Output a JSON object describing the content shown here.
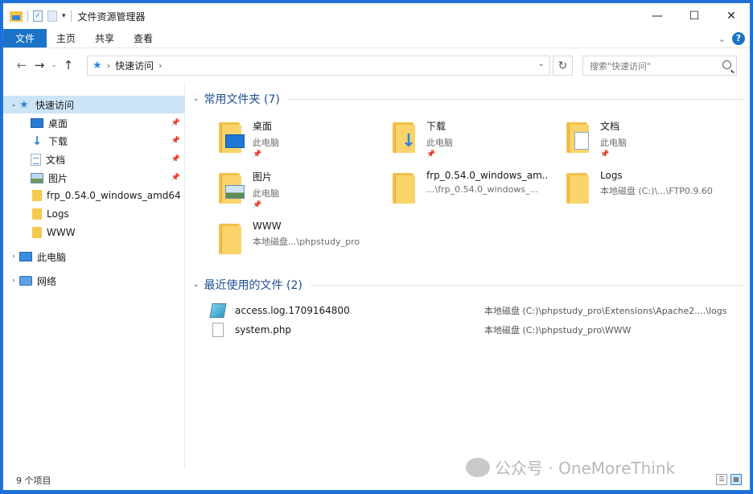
{
  "window": {
    "title": "文件资源管理器"
  },
  "ribbon": {
    "tabs": [
      "文件",
      "主页",
      "共享",
      "查看"
    ]
  },
  "navbar": {
    "breadcrumb": "快速访问",
    "search_placeholder": "搜索\"快速访问\""
  },
  "sidebar": {
    "items": [
      {
        "label": "快速访问"
      },
      {
        "label": "桌面"
      },
      {
        "label": "下载"
      },
      {
        "label": "文档"
      },
      {
        "label": "图片"
      },
      {
        "label": "frp_0.54.0_windows_amd64"
      },
      {
        "label": "Logs"
      },
      {
        "label": "WWW"
      },
      {
        "label": "此电脑"
      },
      {
        "label": "网络"
      }
    ]
  },
  "frequent": {
    "header": "常用文件夹 (7)",
    "folders": [
      {
        "name": "桌面",
        "location": "此电脑"
      },
      {
        "name": "下载",
        "location": "此电脑"
      },
      {
        "name": "文档",
        "location": "此电脑"
      },
      {
        "name": "图片",
        "location": "此电脑"
      },
      {
        "name": "frp_0.54.0_windows_am...",
        "location": "...\\frp_0.54.0_windows_..."
      },
      {
        "name": "Logs",
        "location": "本地磁盘 (C:)\\...\\FTP0.9.60"
      },
      {
        "name": "WWW",
        "location": "本地磁盘...\\phpstudy_pro"
      }
    ]
  },
  "recent": {
    "header": "最近使用的文件 (2)",
    "files": [
      {
        "name": "access.log.1709164800",
        "path": "本地磁盘 (C:)\\phpstudy_pro\\Extensions\\Apache2....\\logs"
      },
      {
        "name": "system.php",
        "path": "本地磁盘 (C:)\\phpstudy_pro\\WWW"
      }
    ]
  },
  "status": {
    "item_count": "9 个项目"
  },
  "watermark": {
    "text": "公众号 · OneMoreThink"
  }
}
